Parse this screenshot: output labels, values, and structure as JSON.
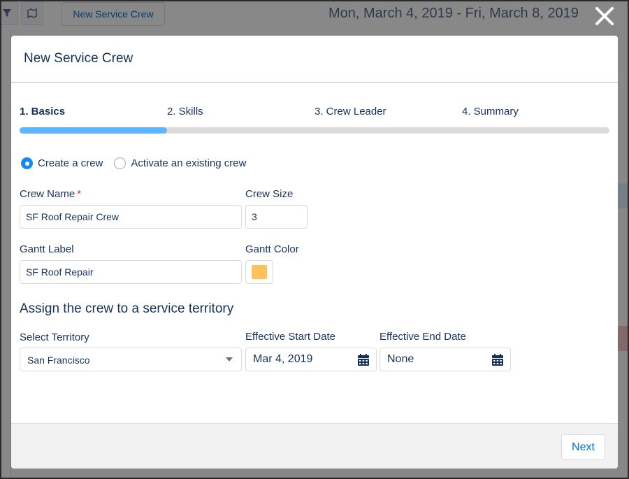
{
  "background": {
    "new_service_crew_label": "New Service Crew",
    "date_range": "Mon, March 4, 2019 - Fri, March 8, 2019",
    "filter_icon": "filter-icon",
    "map_icon": "map-icon"
  },
  "modal": {
    "title": "New Service Crew",
    "close_icon": "close-icon",
    "steps": [
      {
        "label": "1. Basics",
        "active": true
      },
      {
        "label": "2. Skills",
        "active": false
      },
      {
        "label": "3. Crew Leader",
        "active": false
      },
      {
        "label": "4. Summary",
        "active": false
      }
    ],
    "progress_percent": 25,
    "mode": {
      "create_label": "Create a crew",
      "activate_label": "Activate an existing crew",
      "selected": "create"
    },
    "form": {
      "crew_name_label": "Crew Name",
      "required_mark": "*",
      "crew_name_value": "SF Roof Repair Crew",
      "crew_size_label": "Crew Size",
      "crew_size_value": "3",
      "gantt_label_label": "Gantt Label",
      "gantt_label_value": "SF Roof Repair",
      "gantt_color_label": "Gantt Color",
      "gantt_color_value": "#ffc35e"
    },
    "territory": {
      "section_title": "Assign the crew to a service territory",
      "select_label": "Select Territory",
      "select_value": "San Francisco",
      "start_label": "Effective Start Date",
      "start_value": "Mar 4, 2019",
      "end_label": "Effective End Date",
      "end_value": "None",
      "calendar_icon": "calendar-icon"
    },
    "footer": {
      "next_label": "Next"
    }
  },
  "colors": {
    "progress_fill": "#5eb4ff",
    "accent": "#1589ee",
    "link": "#0070d2",
    "required": "#c23934"
  }
}
